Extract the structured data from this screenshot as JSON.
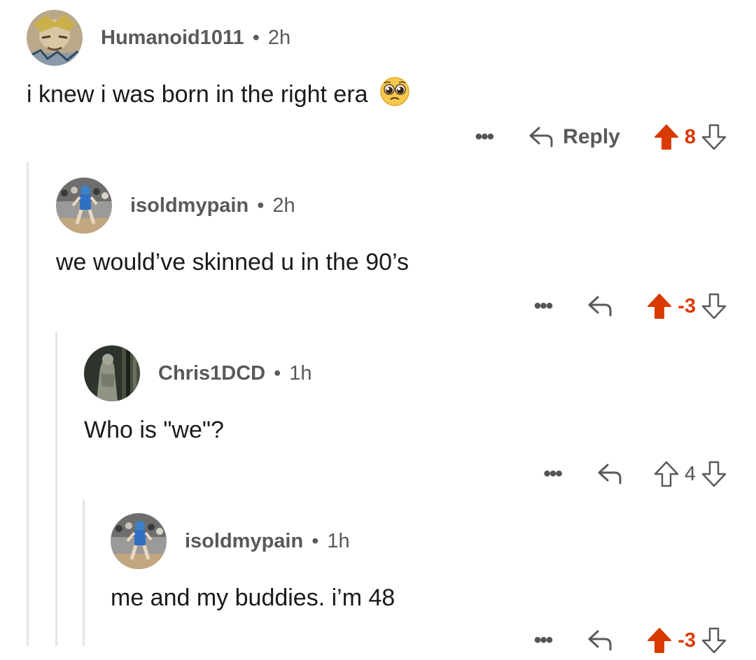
{
  "colors": {
    "upvote_active": "#d93a00",
    "icon_gray": "#58595b",
    "thread_line": "#e6e6e6"
  },
  "comments": [
    {
      "username": "Humanoid1011",
      "time": "2h",
      "text": "i knew i was born in the right era",
      "emoji": "pleading-face-emoji",
      "more_icon": "more-options-icon",
      "reply_label": "Reply",
      "votes": "8",
      "upvoted": true
    },
    {
      "username": "isoldmypain",
      "time": "2h",
      "text": "we would’ve skinned u in the 90’s",
      "more_icon": "more-options-icon",
      "votes": "-3",
      "upvoted": true
    },
    {
      "username": "Chris1DCD",
      "time": "1h",
      "text": "Who is \"we\"?",
      "more_icon": "more-options-icon",
      "votes": "4",
      "upvoted": false
    },
    {
      "username": "isoldmypain",
      "time": "1h",
      "text": "me and my buddies. i’m 48",
      "more_icon": "more-options-icon",
      "votes": "-3",
      "upvoted": true
    }
  ]
}
